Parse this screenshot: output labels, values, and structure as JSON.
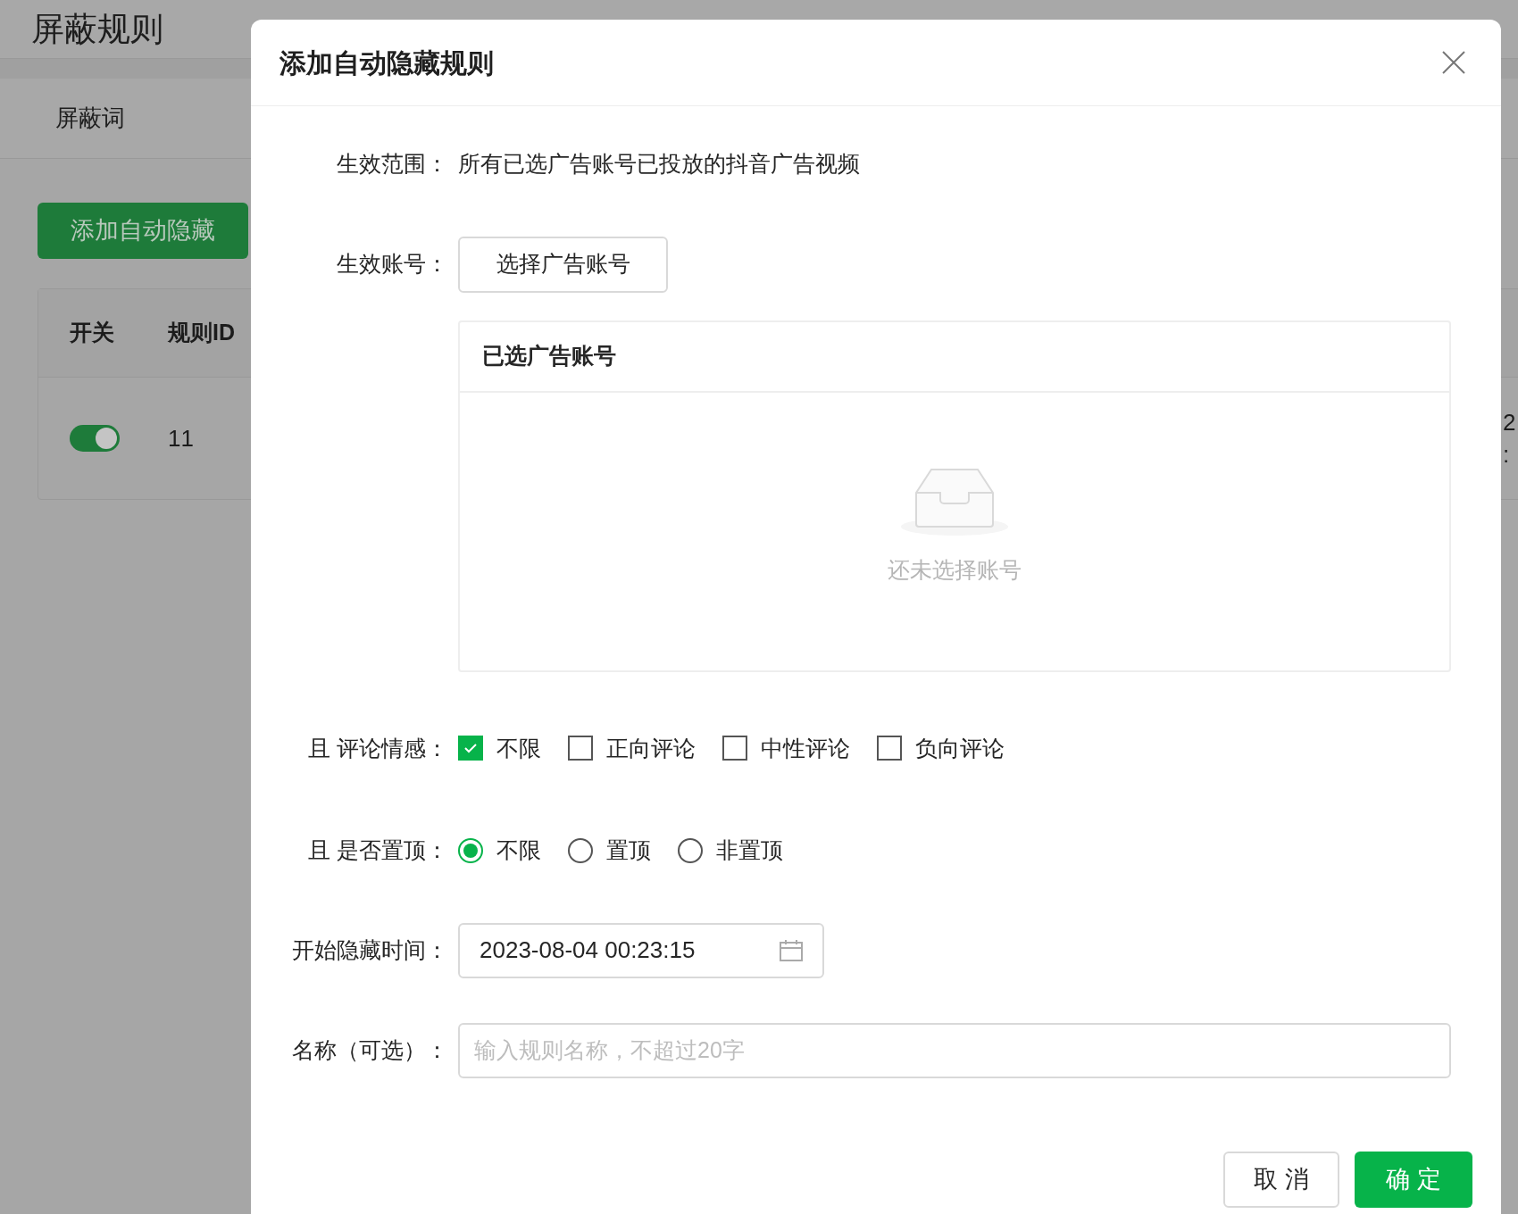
{
  "page": {
    "title": "屏蔽规则",
    "tab": "屏蔽词",
    "add_button": "添加自动隐藏",
    "table": {
      "columns": [
        "开关",
        "规则ID"
      ],
      "rows": [
        {
          "on": true,
          "id": "11",
          "edge_lines": [
            "2",
            ":"
          ]
        }
      ]
    }
  },
  "dialog": {
    "title": "添加自动隐藏规则",
    "scope": {
      "label": "生效范围：",
      "value": "所有已选广告账号已投放的抖音广告视频"
    },
    "accounts": {
      "label": "生效账号：",
      "button": "选择广告账号",
      "panel_title": "已选广告账号",
      "empty_text": "还未选择账号"
    },
    "sentiment": {
      "label": "且 评论情感：",
      "options": [
        {
          "label": "不限",
          "checked": true
        },
        {
          "label": "正向评论",
          "checked": false
        },
        {
          "label": "中性评论",
          "checked": false
        },
        {
          "label": "负向评论",
          "checked": false
        }
      ]
    },
    "pinned": {
      "label": "且 是否置顶：",
      "options": [
        {
          "label": "不限",
          "selected": true
        },
        {
          "label": "置顶",
          "selected": false
        },
        {
          "label": "非置顶",
          "selected": false
        }
      ]
    },
    "start_time": {
      "label": "开始隐藏时间：",
      "value": "2023-08-04 00:23:15"
    },
    "name": {
      "label": "名称（可选）：",
      "placeholder": "输入规则名称，不超过20字"
    },
    "buttons": {
      "cancel": "取 消",
      "confirm": "确 定"
    }
  }
}
